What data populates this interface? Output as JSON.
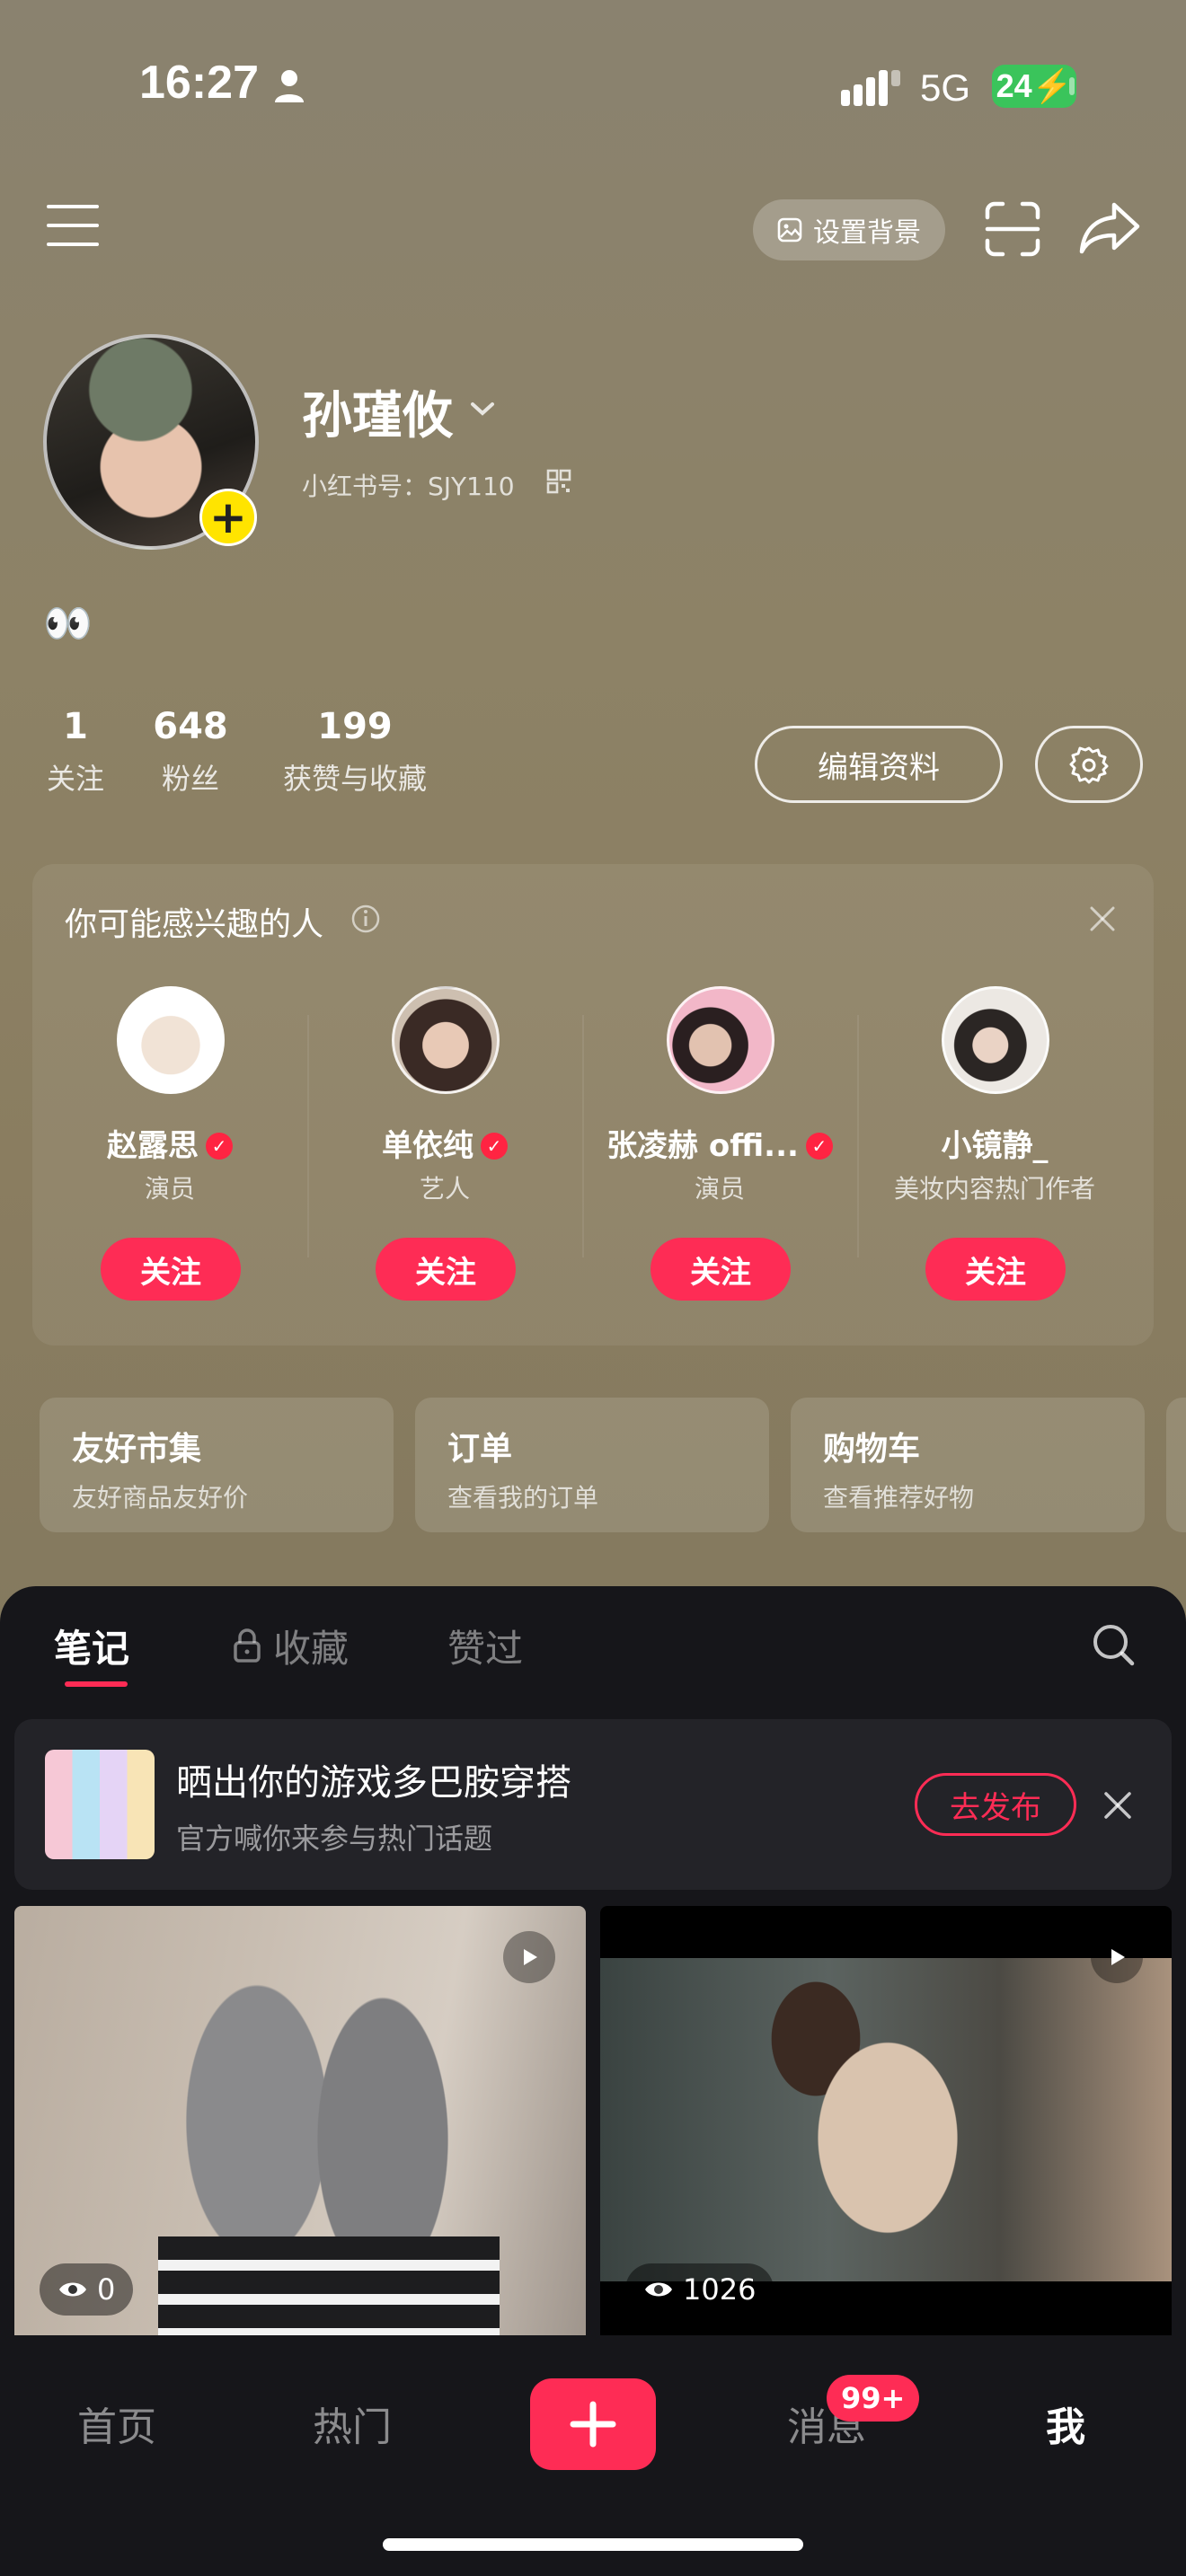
{
  "status_bar": {
    "time": "16:27",
    "network": "5G",
    "battery": "24"
  },
  "top_nav": {
    "set_background_label": "设置背景"
  },
  "profile": {
    "name": "孙瑾攸",
    "id_label": "小红书号：SJY110",
    "bio": "👀",
    "stats": [
      {
        "value": "1",
        "label": "关注"
      },
      {
        "value": "648",
        "label": "粉丝"
      },
      {
        "value": "199",
        "label": "获赞与收藏"
      }
    ],
    "edit_label": "编辑资料"
  },
  "suggestions": {
    "title": "你可能感兴趣的人",
    "people": [
      {
        "name": "赵露思",
        "role": "演员",
        "verified": true,
        "follow": "关注"
      },
      {
        "name": "单依纯",
        "role": "艺人",
        "verified": true,
        "follow": "关注"
      },
      {
        "name": "张凌赫 offi...",
        "role": "演员",
        "verified": true,
        "follow": "关注"
      },
      {
        "name": "小镜静_",
        "role": "美妆内容热门作者",
        "verified": false,
        "follow": "关注"
      }
    ]
  },
  "shortcuts": [
    {
      "title": "友好市集",
      "subtitle": "友好商品友好价"
    },
    {
      "title": "订单",
      "subtitle": "查看我的订单"
    },
    {
      "title": "购物车",
      "subtitle": "查看推荐好物"
    }
  ],
  "tabs": [
    {
      "label": "笔记",
      "active": true
    },
    {
      "label": "收藏",
      "active": false,
      "locked": true
    },
    {
      "label": "赞过",
      "active": false
    }
  ],
  "promo": {
    "title": "晒出你的游戏多巴胺穿搭",
    "subtitle": "官方喊你来参与热门话题",
    "button": "去发布"
  },
  "notes": [
    {
      "views": "0",
      "type": "video"
    },
    {
      "views": "1026",
      "type": "video"
    }
  ],
  "bottom_nav": {
    "home": "首页",
    "hot": "热门",
    "messages": "消息",
    "messages_badge": "99+",
    "me": "我"
  },
  "colors": {
    "accent": "#fe2c55",
    "panel": "#16161a",
    "avatar_plus": "#ffe400",
    "battery": "#3ac45b"
  }
}
